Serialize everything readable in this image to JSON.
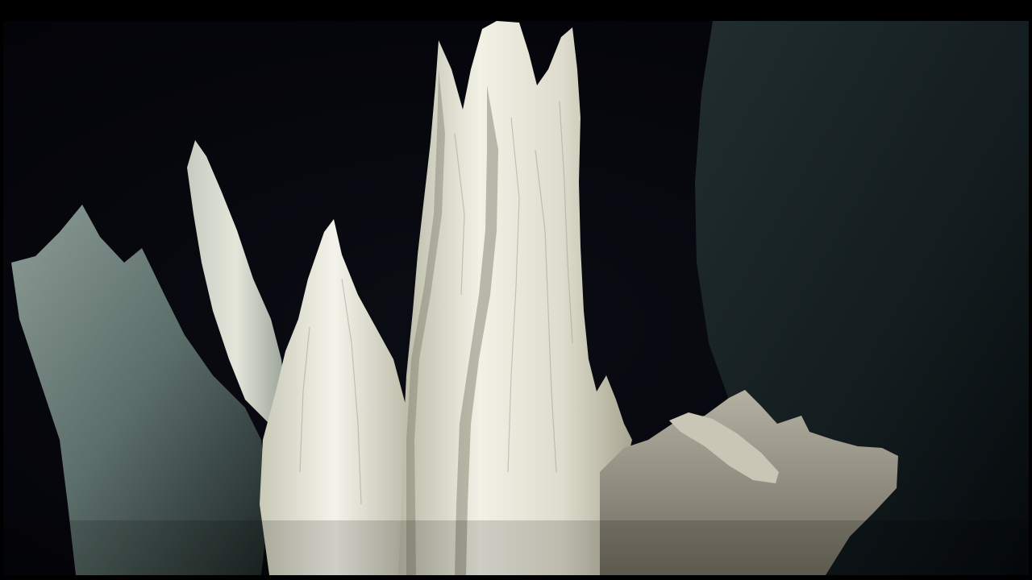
{
  "image": {
    "subject": "underwater-white-chimney-spires",
    "colors": {
      "water_deep": "#03030a",
      "water_mid": "#0a1014",
      "right_cliff": "#1a2628",
      "spire_bright": "#eeeee2",
      "spire_mid": "#cfcfbe",
      "spire_shadow": "#8a8a78",
      "left_mound": "#5a6a66",
      "base_rock": "#a7a294"
    }
  }
}
